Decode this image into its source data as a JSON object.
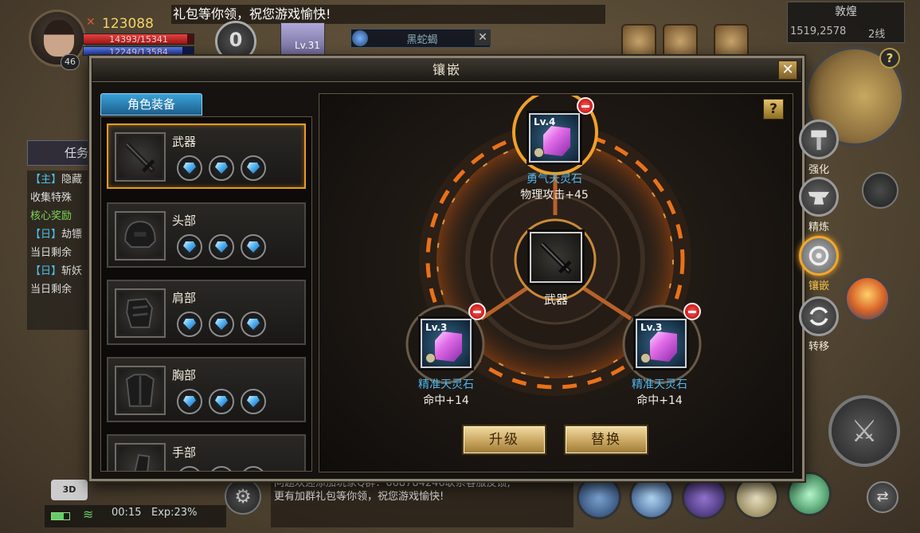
{
  "hud": {
    "power": "123088",
    "hp_text": "14393/15341",
    "hp_fraction": 0.94,
    "mp_text": "12249/13584",
    "mp_fraction": 0.9,
    "level": "46",
    "ticker": "礼包等你领，祝您游戏愉快!",
    "vip_level": "0",
    "pet_level": "Lv.31",
    "target_name": "黑蛇蝎",
    "location": "敦煌",
    "coords": "1519,2578",
    "line": "2线",
    "quest_tab_label": "任务",
    "quest_lines": [
      {
        "tag": "【主】",
        "text": "隐藏"
      },
      {
        "tag": "",
        "text": "收集特殊"
      },
      {
        "tag": "",
        "text": "核心奖励"
      },
      {
        "tag": "【日】",
        "text": "劫镖"
      },
      {
        "tag": "",
        "text": "当日剩余"
      },
      {
        "tag": "【日】",
        "text": "斩妖"
      },
      {
        "tag": "",
        "text": "当日剩余"
      }
    ],
    "cam_label": "3D",
    "time": "00:15",
    "exp": "Exp:23%",
    "chat_lines": [
      "问题欢迎添加玩家Q群：668784246联系客服反馈,",
      "更有加群礼包等你领，祝您游戏愉快!"
    ]
  },
  "dialog": {
    "title": "镶嵌",
    "close_label": "✕",
    "equip_tab": "角色装备",
    "help_label": "?",
    "slots": [
      {
        "name": "武器",
        "selected": true
      },
      {
        "name": "头部",
        "selected": false
      },
      {
        "name": "肩部",
        "selected": false
      },
      {
        "name": "胸部",
        "selected": false
      },
      {
        "name": "手部",
        "selected": false
      }
    ],
    "center_item": "武器",
    "sockets": {
      "top": {
        "level": "Lv.4",
        "name": "勇气天灵石",
        "stat": "物理攻击+45"
      },
      "left": {
        "level": "Lv.3",
        "name": "精准天灵石",
        "stat": "命中+14"
      },
      "right": {
        "level": "Lv.3",
        "name": "精准天灵石",
        "stat": "命中+14"
      }
    },
    "upgrade_button": "升级",
    "replace_button": "替换",
    "side_tabs": [
      {
        "label": "强化",
        "icon": "hammer-icon",
        "active": false
      },
      {
        "label": "精炼",
        "icon": "anvil-icon",
        "active": false
      },
      {
        "label": "镶嵌",
        "icon": "inlay-icon",
        "active": true
      },
      {
        "label": "转移",
        "icon": "transfer-icon",
        "active": false
      }
    ]
  },
  "colors": {
    "accent_gold": "#e89a22",
    "gem_name_blue": "#4fb7ee",
    "fire_ring": "#ff7a1a"
  }
}
